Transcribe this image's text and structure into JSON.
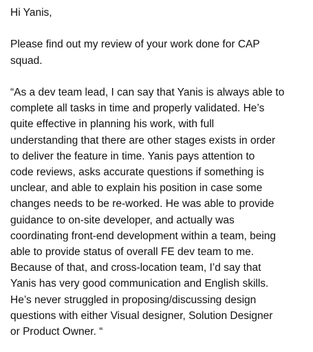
{
  "letter": {
    "greeting": "Hi Yanis,",
    "intro_lines": [
      "Please find out my review of your work done for CAP",
      "squad."
    ],
    "quote_lines": [
      "“As a dev team lead, I can say that Yanis is always able to",
      "complete all tasks in time and properly validated. He’s",
      "quite effective in planning his work, with full",
      "understanding that there are other stages exists in order",
      "to deliver the feature in time. Yanis pays attention to",
      "code reviews, asks accurate questions if something is",
      "unclear, and able to explain his position in case some",
      "changes needs to be re-worked. He was able to provide",
      "guidance to on-site developer, and actually was",
      "coordinating front-end development within a team, being",
      "able to provide status of overall FE dev team to me.",
      "Because of that, and cross-location team, I’d say that",
      "Yanis has very good communication and English skills.",
      "He’s never struggled in proposing/discussing design",
      "questions with either Visual designer, Solution Designer",
      "or Product Owner. “"
    ]
  }
}
